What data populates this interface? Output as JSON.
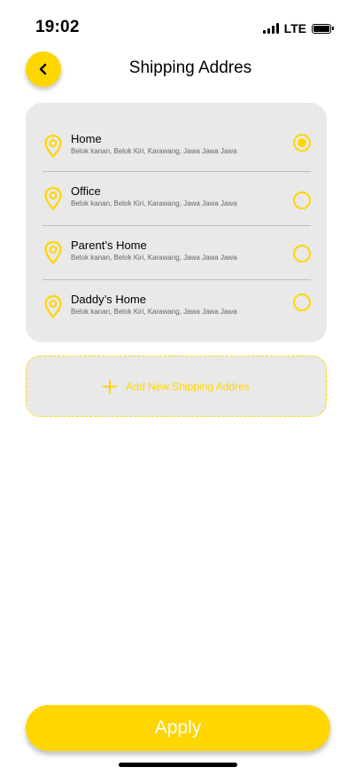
{
  "status_bar": {
    "time": "19:02",
    "network": "LTE",
    "signal_icon": "signal-bars-icon",
    "battery_icon": "battery-full-icon"
  },
  "header": {
    "title": "Shipping Addres",
    "back_icon": "chevron-left-icon"
  },
  "addresses": [
    {
      "name": "Home",
      "detail": "Belok kanan, Belok Kiri, Karawang, Jawa Jawa Jawa",
      "selected": true
    },
    {
      "name": "Office",
      "detail": "Belok kanan, Belok Kiri, Karawang, Jawa Jawa Jawa",
      "selected": false
    },
    {
      "name": "Parent’s Home",
      "detail": "Belok kanan, Belok Kiri, Karawang, Jawa Jawa Jawa",
      "selected": false
    },
    {
      "name": "Daddy’s Home",
      "detail": "Belok kanan, Belok Kiri, Karawang, Jawa Jawa Jawa",
      "selected": false
    }
  ],
  "add_address": {
    "label": "Add New Shipping Addres",
    "icon": "plus-icon"
  },
  "apply_button": {
    "label": "Apply"
  },
  "colors": {
    "accent": "#FFD600",
    "card_background": "#E9E9E9",
    "detail_text": "#666666"
  }
}
